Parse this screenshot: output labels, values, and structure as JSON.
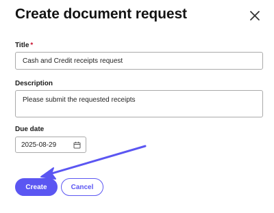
{
  "dialog": {
    "title": "Create document request",
    "close_icon": "close-icon"
  },
  "form": {
    "title_label": "Title",
    "title_required_mark": "*",
    "title_value": "Cash and Credit receipts request",
    "description_label": "Description",
    "description_value": "Please submit the requested receipts",
    "due_date_label": "Due date",
    "due_date_value": "2025-08-29",
    "calendar_icon": "calendar-icon"
  },
  "actions": {
    "create_label": "Create",
    "cancel_label": "Cancel"
  },
  "colors": {
    "accent": "#5b56f2",
    "required": "#c8102e",
    "annotation_arrow": "#5b56f2"
  }
}
